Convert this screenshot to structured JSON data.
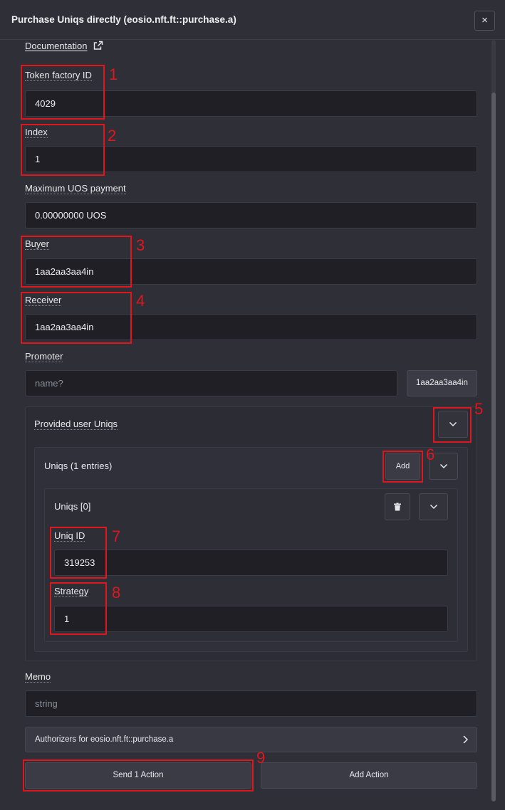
{
  "dialog": {
    "title": "Purchase Uniqs directly (eosio.nft.ft::purchase.a)",
    "close_glyph": "×"
  },
  "documentation": {
    "label": "Documentation",
    "icon": "external-link-icon"
  },
  "fields": {
    "token_factory_id": {
      "label": "Token factory ID",
      "value": "4029"
    },
    "index": {
      "label": "Index",
      "value": "1"
    },
    "max_uos_payment": {
      "label": "Maximum UOS payment",
      "value": "0.00000000 UOS"
    },
    "buyer": {
      "label": "Buyer",
      "value": "1aa2aa3aa4in"
    },
    "receiver": {
      "label": "Receiver",
      "value": "1aa2aa3aa4in"
    },
    "promoter": {
      "label": "Promoter",
      "placeholder": "name?",
      "button_label": "1aa2aa3aa4in"
    },
    "memo": {
      "label": "Memo",
      "placeholder": "string"
    }
  },
  "provided_user_uniqs": {
    "title": "Provided user Uniqs",
    "uniqs": {
      "title": "Uniqs (1 entries)",
      "add_label": "Add",
      "entry": {
        "title": "Uniqs [0]",
        "uniq_id": {
          "label": "Uniq ID",
          "value": "319253"
        },
        "strategy": {
          "label": "Strategy",
          "value": "1"
        }
      }
    }
  },
  "authorizers": {
    "label": "Authorizers for eosio.nft.ft::purchase.a"
  },
  "actions": {
    "send_label": "Send 1 Action",
    "add_label": "Add Action"
  },
  "annotations": [
    "1",
    "2",
    "3",
    "4",
    "5",
    "6",
    "7",
    "8",
    "9"
  ],
  "colors": {
    "annotation": "#e0161c",
    "background": "#2f2f38",
    "input_bg": "#1f1f25"
  }
}
